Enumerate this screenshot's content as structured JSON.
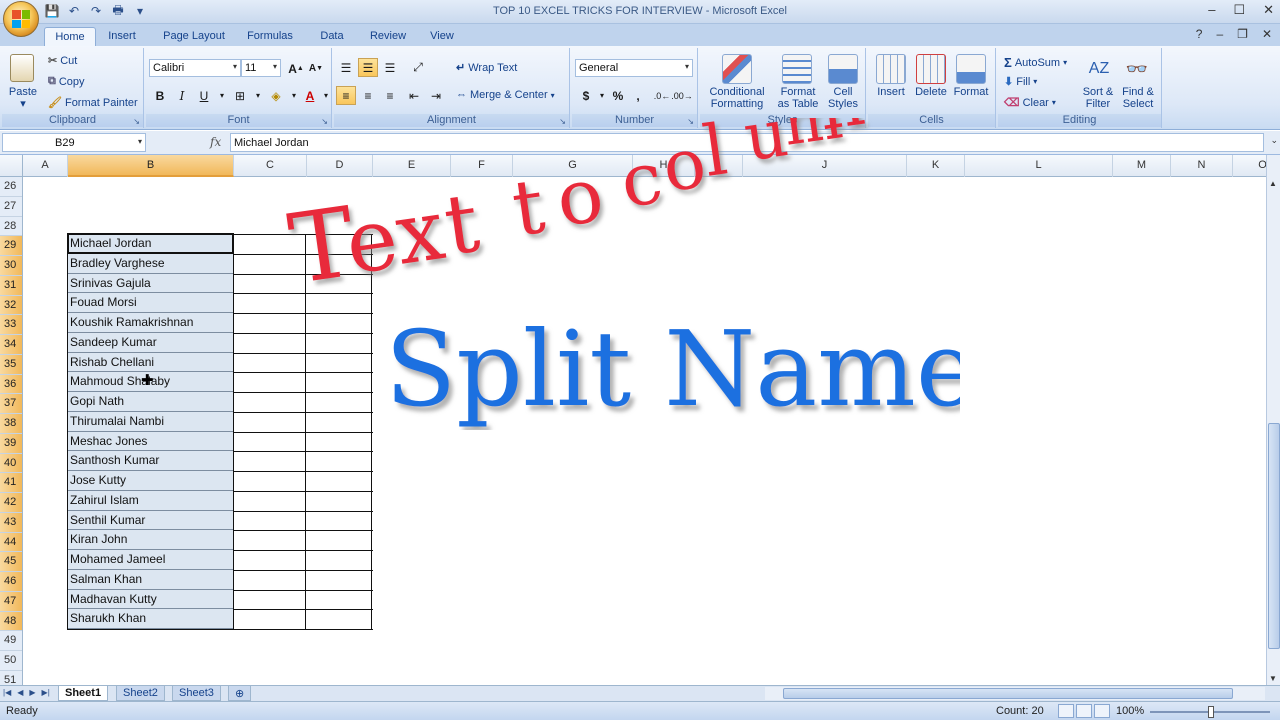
{
  "window": {
    "title": "TOP 10 EXCEL TRICKS FOR INTERVIEW - Microsoft Excel",
    "controls": [
      "–",
      "☐",
      "✕"
    ]
  },
  "tabs": [
    "Home",
    "Insert",
    "Page Layout",
    "Formulas",
    "Data",
    "Review",
    "View"
  ],
  "ribbon": {
    "clipboard": {
      "paste": "Paste",
      "cut": "Cut",
      "copy": "Copy",
      "format_painter": "Format Painter",
      "label": "Clipboard"
    },
    "font": {
      "name": "Calibri",
      "size": "11",
      "label": "Font"
    },
    "alignment": {
      "wrap_text": "Wrap Text",
      "merge_center": "Merge & Center",
      "label": "Alignment"
    },
    "number": {
      "format": "General",
      "currency": "$",
      "percent": "%",
      "comma": ",",
      "label": "Number"
    },
    "styles": {
      "conditional": [
        "Conditional",
        "Formatting"
      ],
      "format_table": [
        "Format",
        "as Table"
      ],
      "cell_styles": [
        "Cell",
        "Styles"
      ],
      "label": "Styles"
    },
    "cells": {
      "insert": "Insert",
      "delete": "Delete",
      "format": "Format",
      "label": "Cells"
    },
    "editing": {
      "autosum": "AutoSum",
      "fill": "Fill",
      "clear": "Clear",
      "sort_filter": [
        "Sort &",
        "Filter"
      ],
      "find_select": [
        "Find &",
        "Select"
      ],
      "label": "Editing"
    }
  },
  "formula_bar": {
    "cell_ref": "B29",
    "fx": "fx",
    "value": "Michael Jordan"
  },
  "columns": [
    "A",
    "B",
    "C",
    "D",
    "E",
    "F",
    "G",
    "H",
    "I",
    "J",
    "K",
    "L",
    "M",
    "N",
    "O"
  ],
  "selected_column": "B",
  "rows": [
    "26",
    "27",
    "28",
    "29",
    "30",
    "31",
    "32",
    "33",
    "34",
    "35",
    "36",
    "37",
    "38",
    "39",
    "40",
    "41",
    "42",
    "43",
    "44",
    "45",
    "46",
    "47",
    "48",
    "49",
    "50",
    "51"
  ],
  "names": [
    "Michael Jordan",
    "Bradley Varghese",
    "Srinivas Gajula",
    "Fouad Morsi",
    "Koushik Ramakrishnan",
    "Sandeep Kumar",
    "Rishab Chellani",
    "Mahmoud Shalaby",
    "Gopi Nath",
    "Thirumalai Nambi",
    "Meshac Jones",
    "Santhosh Kumar",
    "Jose Kutty",
    "Zahirul Islam",
    "Senthil Kumar",
    "Kiran John",
    "Mohamed Jameel",
    "Salman Khan",
    "Madhavan Kutty",
    "Sharukh Khan"
  ],
  "overlay": {
    "line1": "Text to column",
    "line2": "Split Name",
    "line1_color": "#e8293b",
    "line2_color": "#1f6fe0"
  },
  "sheets": [
    "Sheet1",
    "Sheet2",
    "Sheet3"
  ],
  "status": {
    "ready": "Ready",
    "count": "Count: 20",
    "zoom": "100%"
  }
}
